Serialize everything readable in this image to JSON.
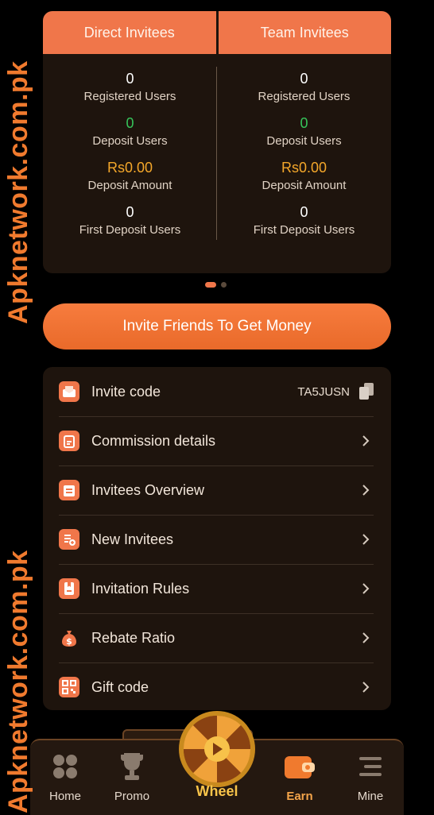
{
  "stats": {
    "tabs": [
      "Direct Invitees",
      "Team Invitees"
    ],
    "columns": [
      {
        "registered": "0",
        "deposit_users": "0",
        "deposit_amount": "Rs0.00",
        "first_deposit": "0"
      },
      {
        "registered": "0",
        "deposit_users": "0",
        "deposit_amount": "Rs0.00",
        "first_deposit": "0"
      }
    ],
    "labels": {
      "registered": "Registered Users",
      "deposit_users": "Deposit Users",
      "deposit_amount": "Deposit Amount",
      "first_deposit": "First Deposit Users"
    }
  },
  "invite_button": "Invite Friends To Get Money",
  "menu": {
    "items": [
      {
        "label": "Invite code",
        "value": "TA5JUSN",
        "icon": "invite-icon"
      },
      {
        "label": "Commission details",
        "icon": "commission-icon"
      },
      {
        "label": "Invitees Overview",
        "icon": "overview-icon"
      },
      {
        "label": "New Invitees",
        "icon": "new-invitees-icon"
      },
      {
        "label": "Invitation Rules",
        "icon": "rules-icon"
      },
      {
        "label": "Rebate Ratio",
        "icon": "money-bag-icon"
      },
      {
        "label": "Gift code",
        "icon": "qr-icon"
      }
    ]
  },
  "nav": {
    "home": "Home",
    "promo": "Promo",
    "wheel": "Wheel",
    "earn": "Earn",
    "mine": "Mine"
  },
  "watermark": "Apknetwork.com.pk",
  "colors": {
    "accent": "#f0764a",
    "green": "#36c45a",
    "gold": "#f4a72a",
    "card": "#1e140d"
  }
}
